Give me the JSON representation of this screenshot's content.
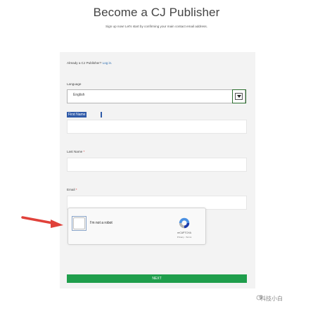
{
  "page": {
    "title": "Become a CJ Publisher",
    "subtitle": "Sign up now! Let's start by confirming your main contact email address."
  },
  "login_prompt": {
    "text": "Already a CJ Publisher?",
    "link": "Log in."
  },
  "form": {
    "language": {
      "label": "Language",
      "selected": "English"
    },
    "first_name": {
      "label": "First Name",
      "required_marker": "*",
      "value": ""
    },
    "last_name": {
      "label": "Last Name",
      "required_marker": "*",
      "value": ""
    },
    "email": {
      "label": "Email",
      "required_marker": "*",
      "value": ""
    },
    "next_label": "NEXT"
  },
  "captcha": {
    "checkbox_label": "I'm not a robot",
    "brand": "reCAPTCHA",
    "links": "Privacy - Terms"
  },
  "watermark": {
    "text": "科技小白"
  },
  "colors": {
    "panel": "#f3f3f3",
    "next_button": "#1f9e4c",
    "selection": "#2f5aa8",
    "arrow": "#e0413a"
  }
}
